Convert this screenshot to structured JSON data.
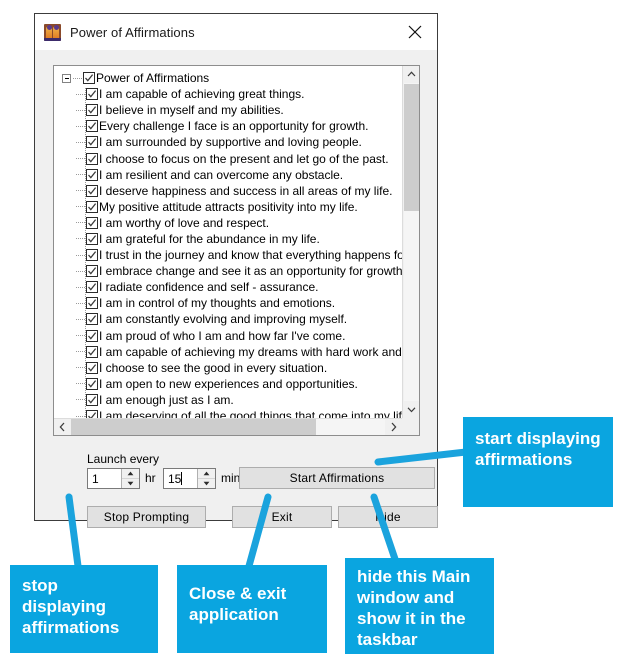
{
  "window": {
    "title": "Power of Affirmations",
    "icon": "app-people-icon",
    "close_label": "✕"
  },
  "tree": {
    "root_label": "Power of Affirmations",
    "root_checked": true,
    "items": [
      "I am capable of achieving great things.",
      "I believe in myself and my abilities.",
      "Every challenge I face is an opportunity for growth.",
      "I am surrounded by supportive and loving people.",
      "I choose to focus on the present and let go of the past.",
      "I am resilient and can overcome any obstacle.",
      "I deserve happiness and success in all areas of my life.",
      " My positive attitude attracts positivity into my life.",
      "I am worthy of love and respect.",
      "I am grateful for the abundance in my life.",
      "I trust in the journey and know that everything happens for",
      "I embrace change and see it as an opportunity for growth.",
      "I radiate confidence and self - assurance.",
      "I am in control of my thoughts and emotions.",
      "I am constantly evolving and improving myself.",
      "I am proud of who I am and how far I've come.",
      "I am capable of achieving my dreams with hard work and d",
      "I choose to see the good in every situation.",
      "I am open to new experiences and opportunities.",
      "I am enough just as I am.",
      "I am deserving of all the good things that come into my life"
    ]
  },
  "controls": {
    "launch_every_label": "Launch every",
    "hours_value": "1",
    "hours_unit": "hr",
    "minutes_value": "15",
    "minutes_unit": "min",
    "start_button": "Start Affirmations",
    "stop_button": "Stop Prompting",
    "exit_button": "Exit",
    "hide_button": "Hide"
  },
  "annotations": {
    "accent_color": "#0aa5e0",
    "start": "start displaying affirmations",
    "stop": "stop displaying affirmations",
    "exit": "Close & exit application",
    "hide": "hide this Main window and show it in the taskbar"
  }
}
